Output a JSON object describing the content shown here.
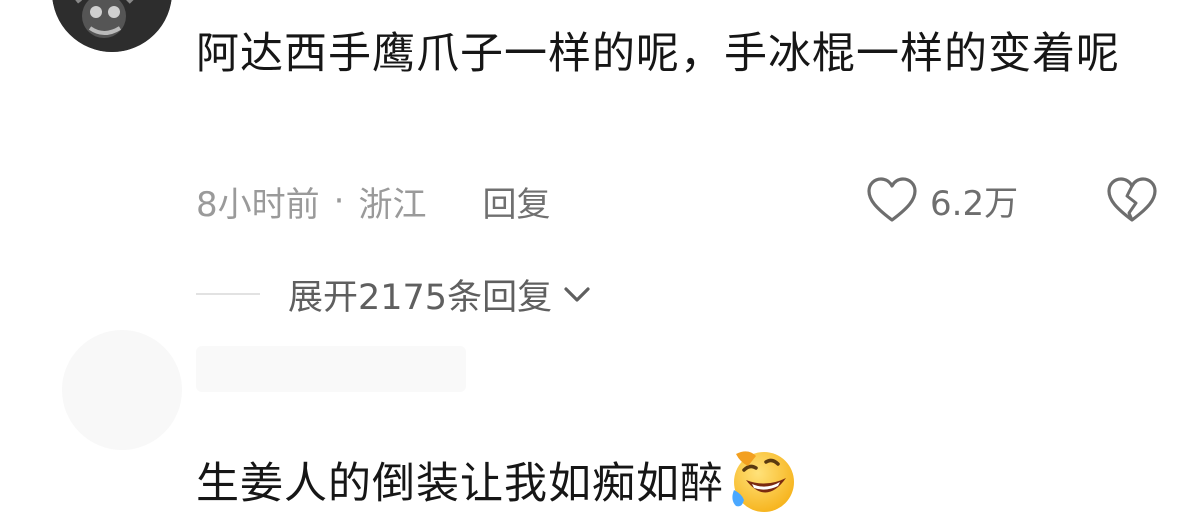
{
  "comment1": {
    "avatar_icon": "avatar-image",
    "text": "阿达西手鹰爪子一样的呢，手冰棍一样的变着呢",
    "time": "8小时前",
    "separator": "·",
    "location": "浙江",
    "reply_label": "回复",
    "like_icon": "heart-outline-icon",
    "like_count": "6.2万",
    "dislike_icon": "broken-heart-icon",
    "expand_label": "展开2175条回复",
    "expand_icon": "chevron-down-icon"
  },
  "comment2": {
    "text": "生姜人的倒装让我如痴如醉",
    "emoji_icon": "rolling-laughing-emoji"
  },
  "colors": {
    "text_primary": "#161616",
    "text_secondary": "#9a9a9a",
    "icon_gray": "#6e6e6e"
  }
}
